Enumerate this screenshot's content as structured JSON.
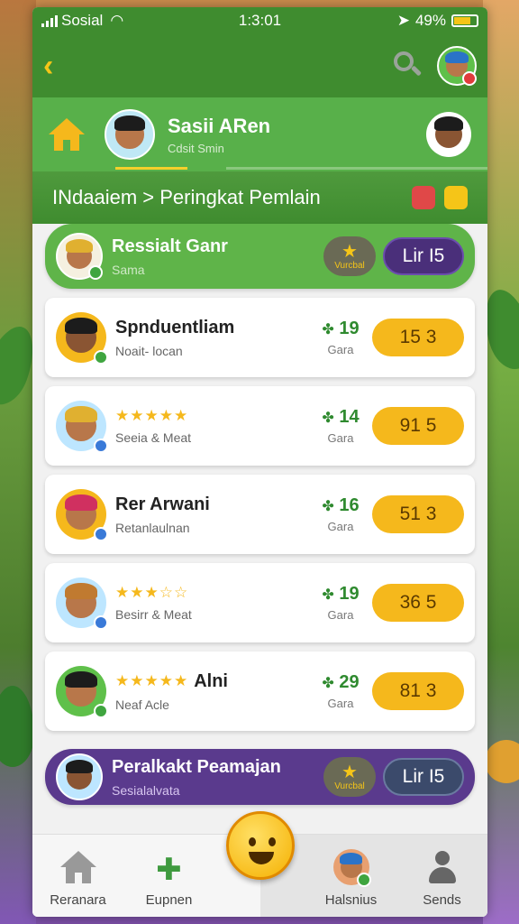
{
  "statusbar": {
    "carrier": "Sosial",
    "time": "1:3:01",
    "battery": "49%"
  },
  "profile": {
    "name": "Sasii ARen",
    "subtitle": "Cdsit Smin"
  },
  "breadcrumb": {
    "text": "INdaaiem > Peringkat Pemlain"
  },
  "current_player": {
    "name": "Ressialt Ganr",
    "subtitle": "Sama",
    "medal_label": "Vurcbal",
    "level": "Lir I5"
  },
  "players": [
    {
      "name": "Spnduentliam",
      "subtitle": "Noait- locan",
      "stars": null,
      "score": "19",
      "score_label": "Gara",
      "points": "15 3",
      "avatar_color": "#f5b81c"
    },
    {
      "name": "",
      "subtitle": "Seeia & Meat",
      "stars": "★★★★★",
      "score": "14",
      "score_label": "Gara",
      "points": "91 5",
      "avatar_color": "#f5f0e0"
    },
    {
      "name": "Rer Arwani",
      "subtitle": "Retanlaulnan",
      "stars": null,
      "score": "16",
      "score_label": "Gara",
      "points": "51 3",
      "avatar_color": "#f5b81c"
    },
    {
      "name": "",
      "subtitle": "Besirr & Meat",
      "stars": "★★★☆☆",
      "score": "19",
      "score_label": "Gara",
      "points": "36 5",
      "avatar_color": "#bde6ff"
    },
    {
      "name": "Alni",
      "subtitle": "Neaf Acle",
      "stars": "★★★★★",
      "score": "29",
      "score_label": "Gara",
      "points": "81 3",
      "avatar_color": "#5fc04a"
    }
  ],
  "bottom_player": {
    "name": "Peralkakt Peamajan",
    "subtitle": "Sesialalvata",
    "medal_label": "Vurcbal",
    "level": "Lir I5"
  },
  "tabs": [
    "Reranara",
    "Eupnen",
    "",
    "Halsnius",
    "Sends"
  ],
  "colors": {
    "primary_green": "#3f8c2f",
    "accent_yellow": "#f5b81c",
    "purple": "#5a3a8d"
  }
}
